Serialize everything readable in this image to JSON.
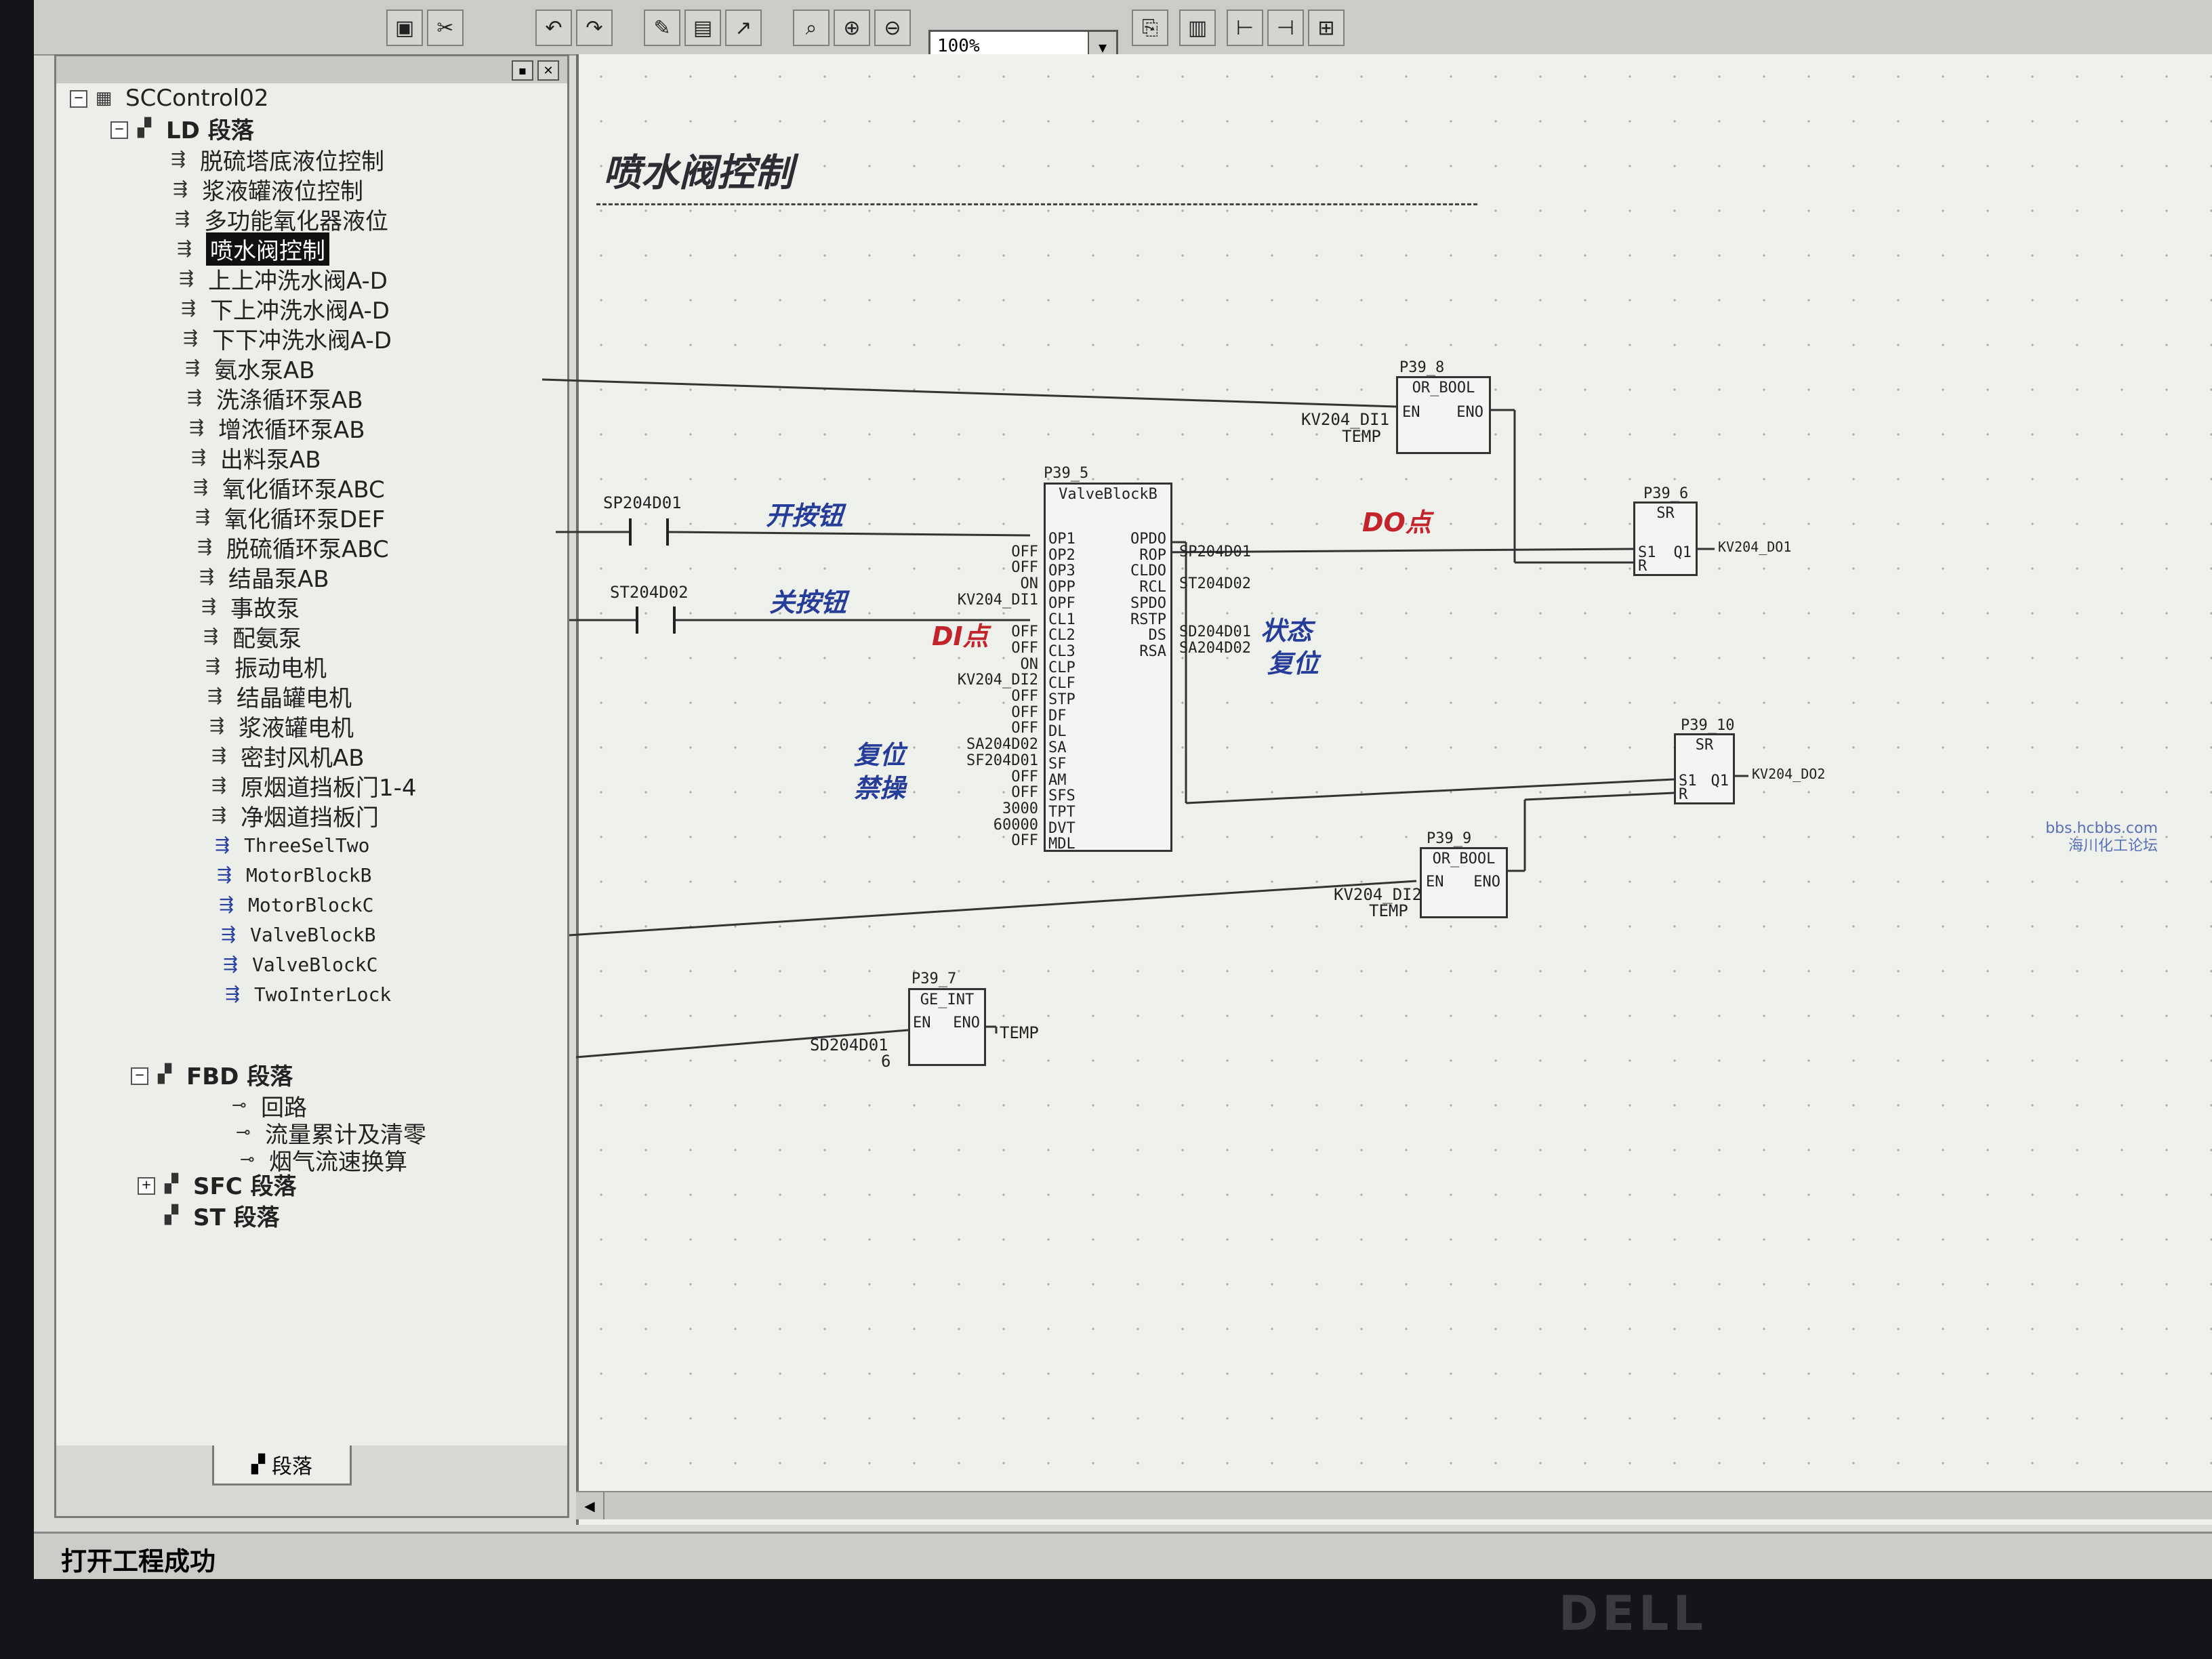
{
  "toolbar": {
    "zoom_value": "100%",
    "icons": [
      "save-icon",
      "cut-icon",
      "undo-icon",
      "redo-icon",
      "edit-icon",
      "window-icon",
      "arrow-icon",
      "find-icon",
      "zoom-in-icon",
      "zoom-out-icon",
      "copy-icon",
      "tool-a-icon",
      "tool-b-icon",
      "tool-c-icon",
      "tool-d-icon"
    ]
  },
  "tree": {
    "root": "SCControl02",
    "ld_group": "LD 段落",
    "ld_items": [
      "脱硫塔底液位控制",
      "浆液罐液位控制",
      "多功能氧化器液位",
      "喷水阀控制",
      "上上冲洗水阀A-D",
      "下上冲洗水阀A-D",
      "下下冲洗水阀A-D",
      "氨水泵AB",
      "洗涤循环泵AB",
      "增浓循环泵AB",
      "出料泵AB",
      "氧化循环泵ABC",
      "氧化循环泵DEF",
      "脱硫循环泵ABC",
      "结晶泵AB",
      "事故泵",
      "配氨泵",
      "振动电机",
      "结晶罐电机",
      "浆液罐电机",
      "密封风机AB",
      "原烟道挡板门1-4",
      "净烟道挡板门"
    ],
    "ld_blocks": [
      "ThreeSelTwo",
      "MotorBlockB",
      "MotorBlockC",
      "ValveBlockB",
      "ValveBlockC",
      "TwoInterLock"
    ],
    "selected_index": 3,
    "fbd_group": "FBD 段落",
    "fbd_items": [
      "回路",
      "流量累计及清零",
      "烟气流速换算"
    ],
    "sfc_group": "SFC 段落",
    "st_group": "ST 段落",
    "tab_label": "段落"
  },
  "status": {
    "message": "打开工程成功"
  },
  "diagram": {
    "title": "喷水阀控制",
    "contacts": {
      "open": "SP204D01",
      "close": "ST204D02"
    },
    "notes": {
      "open_btn": "开按钮",
      "close_btn": "关按钮",
      "di_point": "DI点",
      "do_point": "DO点",
      "status_word": "状态",
      "reset_word": "复位",
      "reset_disable_1": "复位",
      "reset_disable_2": "禁操"
    },
    "valve_block": {
      "tag": "P39_5",
      "type": "ValveBlockB",
      "inputs": [
        "OP1",
        "OP2",
        "OP3",
        "OPP",
        "OPF",
        "CL1",
        "CL2",
        "CL3",
        "CLP",
        "CLF",
        "STP",
        "DF",
        "DL",
        "SA",
        "SF",
        "AM",
        "SFS",
        "TPT",
        "DVT",
        "MDL"
      ],
      "input_values": [
        "",
        "OFF",
        "OFF",
        "ON",
        "KV204_DI1",
        "",
        "OFF",
        "OFF",
        "ON",
        "KV204_DI2",
        "OFF",
        "OFF",
        "OFF",
        "SA204D02",
        "SF204D01",
        "OFF",
        "OFF",
        "3000",
        "60000",
        "OFF"
      ],
      "outputs": [
        "OPDO",
        "ROP",
        "CLDO",
        "RCL",
        "SPDO",
        "RSTP",
        "DS",
        "RSA"
      ],
      "output_values": [
        "",
        "SP204D01",
        "",
        "ST204D02",
        "",
        "",
        "SD204D01",
        "SA204D02"
      ]
    },
    "or_bool_top": {
      "tag": "P39_8",
      "type": "OR_BOOL",
      "in_en": "EN",
      "out_eno": "ENO",
      "in1": "KV204_DI1",
      "in2": "TEMP"
    },
    "or_bool_bottom": {
      "tag": "P39_9",
      "type": "OR_BOOL",
      "in_en": "EN",
      "out_eno": "ENO",
      "in1": "KV204_DI2",
      "in2": "TEMP"
    },
    "sr_top": {
      "tag": "P39_6",
      "type": "SR",
      "in_s": "S1",
      "in_r": "R",
      "out": "Q1",
      "out_var": "KV204_DO1"
    },
    "sr_bottom": {
      "tag": "P39_10",
      "type": "SR",
      "in_s": "S1",
      "in_r": "R",
      "out": "Q1",
      "out_var": "KV204_DO2"
    },
    "ge_int": {
      "tag": "P39_7",
      "type": "GE_INT",
      "in_en": "EN",
      "out_eno": "ENO",
      "in1": "SD204D01",
      "in2": "6",
      "out_var": "TEMP"
    }
  },
  "watermark": {
    "line1": "bbs.hcbbs.com",
    "line2": "海川化工论坛"
  },
  "monitor_brand": "DELL"
}
